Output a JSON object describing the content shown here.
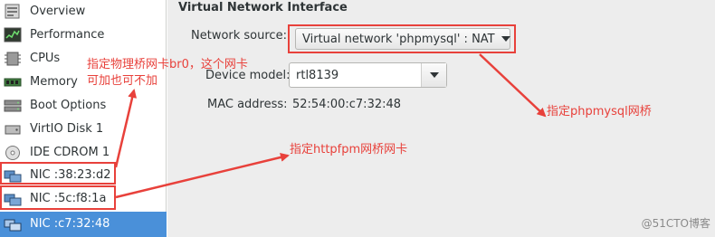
{
  "sidebar": {
    "items": [
      {
        "label": "Overview",
        "icon": "overview-icon"
      },
      {
        "label": "Performance",
        "icon": "performance-icon"
      },
      {
        "label": "CPUs",
        "icon": "cpu-icon"
      },
      {
        "label": "Memory",
        "icon": "memory-icon"
      },
      {
        "label": "Boot Options",
        "icon": "boot-options-icon"
      },
      {
        "label": "VirtIO Disk 1",
        "icon": "disk-icon"
      },
      {
        "label": "IDE CDROM 1",
        "icon": "cdrom-icon"
      },
      {
        "label": "NIC :38:23:d2",
        "icon": "nic-icon"
      },
      {
        "label": "NIC :5c:f8:1a",
        "icon": "nic-icon"
      },
      {
        "label": "NIC :c7:32:48",
        "icon": "nic-icon",
        "selected": true
      }
    ]
  },
  "main": {
    "section_title": "Virtual Network Interface",
    "network_source_label": "Network source:",
    "network_source_value": "Virtual network 'phpmysql' : NAT",
    "device_model_label": "Device model:",
    "device_model_value": "rtl8139",
    "mac_label": "MAC address:",
    "mac_value": "52:54:00:c7:32:48"
  },
  "annotations": {
    "note_bridge_line1": "指定物理桥网卡br0，这个网卡",
    "note_bridge_line2": "可加也可不加",
    "note_httpfpm": "指定httpfpm网桥网卡",
    "note_phpmysql": "指定phpmysql网桥"
  },
  "watermark": "@51CTO博客",
  "colors": {
    "annotation_red": "#e8413b",
    "selection_blue": "#4a90d9",
    "panel_bg": "#ededed"
  }
}
